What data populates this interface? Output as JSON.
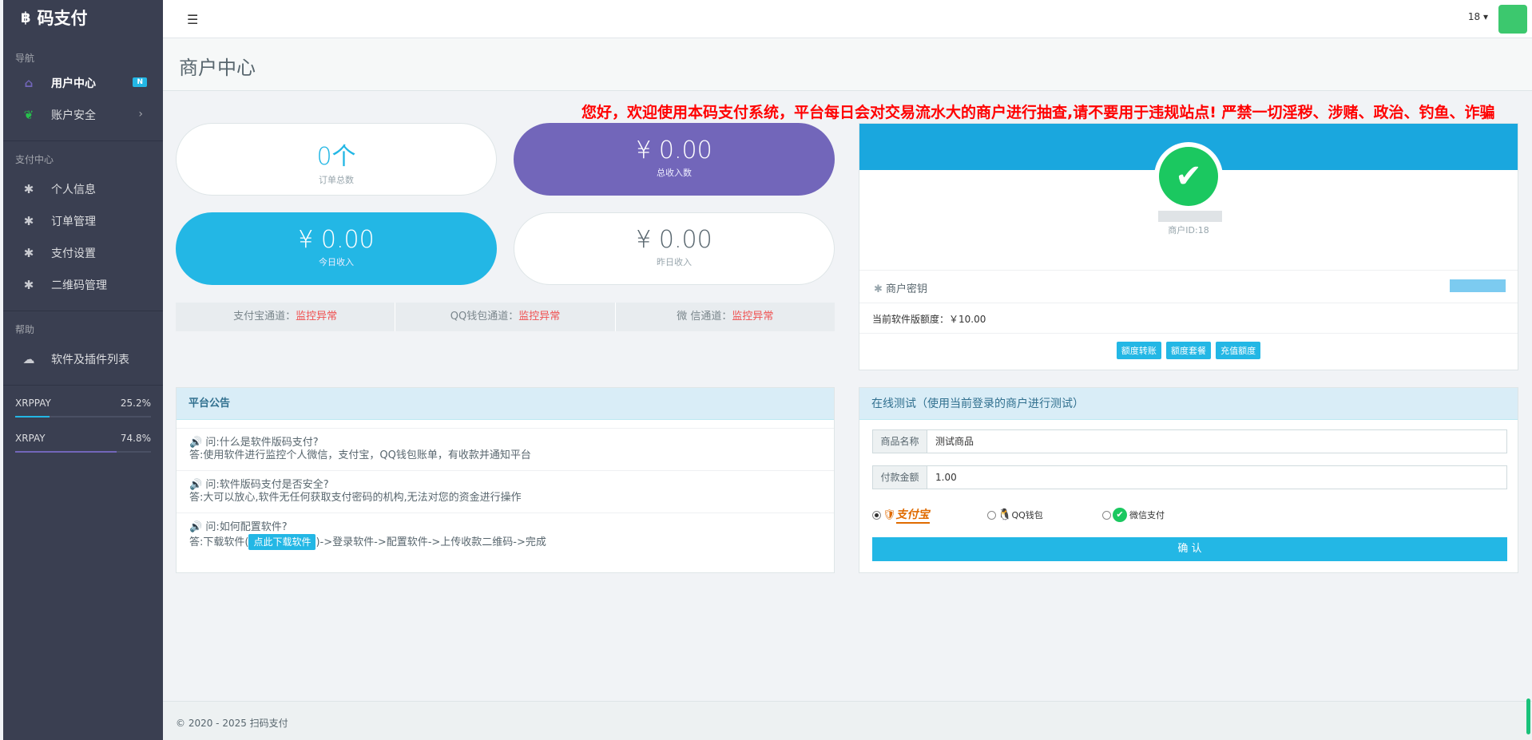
{
  "brand": {
    "logo_symbol": "฿",
    "name": "码支付"
  },
  "sidebar": {
    "section_nav": "导航",
    "user_center": {
      "label": "用户中心",
      "badge": "N",
      "icon": "home-icon"
    },
    "account_security": {
      "label": "账户安全",
      "icon": "leaf-icon"
    },
    "section_pay": "支付中心",
    "pay_items": [
      {
        "label": "个人信息",
        "icon": "gear-icon"
      },
      {
        "label": "订单管理",
        "icon": "gear-icon"
      },
      {
        "label": "支付设置",
        "icon": "gear-icon"
      },
      {
        "label": "二维码管理",
        "icon": "gear-icon"
      }
    ],
    "section_help": "帮助",
    "software_list": {
      "label": "软件及插件列表",
      "icon": "cloud-download-icon"
    },
    "progress": [
      {
        "label": "XRPPAY",
        "percent_text": "25.2%",
        "value": 0.252,
        "color": "#23b7e5"
      },
      {
        "label": "XRPAY",
        "percent_text": "74.8%",
        "value": 0.748,
        "color": "#7266ba"
      }
    ]
  },
  "header": {
    "user": "18 ▾"
  },
  "page_title": "商户中心",
  "notice_banner": "您好，欢迎使用本码支付系统，平台每日会对交易流水大的商户进行抽查,请不要用于违规站点! 严禁一切淫秽、涉赌、政治、钓鱼、诈骗",
  "stats": [
    {
      "value": "0个",
      "label": "订单总数"
    },
    {
      "value": "¥ 0.00",
      "label": "总收入数"
    },
    {
      "value": "¥ 0.00",
      "label": "今日收入"
    },
    {
      "value": "¥ 0.00",
      "label": "昨日收入"
    }
  ],
  "channels": [
    {
      "name": "支付宝通道：",
      "status": "监控异常"
    },
    {
      "name": "QQ钱包通道：",
      "status": "监控异常"
    },
    {
      "name": "微 信通道：",
      "status": "监控异常"
    }
  ],
  "announcement": {
    "title": "平台公告",
    "faqs": [
      {
        "q": "问:什么是软件版码支付?",
        "a": "答:使用软件进行监控个人微信，支付宝，QQ钱包账单，有收款并通知平台"
      },
      {
        "q": "问:软件版码支付是否安全?",
        "a": "答:大可以放心,软件无任何获取支付密码的机构,无法对您的资金进行操作"
      },
      {
        "q": "问:如何配置软件?",
        "a_prefix": "答:下载软件(",
        "a_button": "点此下载软件",
        "a_suffix": ")->登录软件->配置软件->上传收款二维码->完成"
      }
    ]
  },
  "profile": {
    "merchant_id": "商户ID:18",
    "secret_label": "商户密钥",
    "quota": "当前软件版额度：￥10.00",
    "buttons": [
      "额度转账",
      "额度套餐",
      "充值额度"
    ]
  },
  "test_form": {
    "title": "在线测试（使用当前登录的商户进行测试）",
    "product_label": "商品名称",
    "product_value": "测试商品",
    "amount_label": "付款金额",
    "amount_value": "1.00",
    "pay_options": [
      {
        "label": "支付宝",
        "selected": true
      },
      {
        "label": "QQ钱包",
        "selected": false
      },
      {
        "label": "微信支付",
        "selected": false
      }
    ],
    "submit": "确 认"
  },
  "footer": "© 2020 - 2025 扫码支付"
}
